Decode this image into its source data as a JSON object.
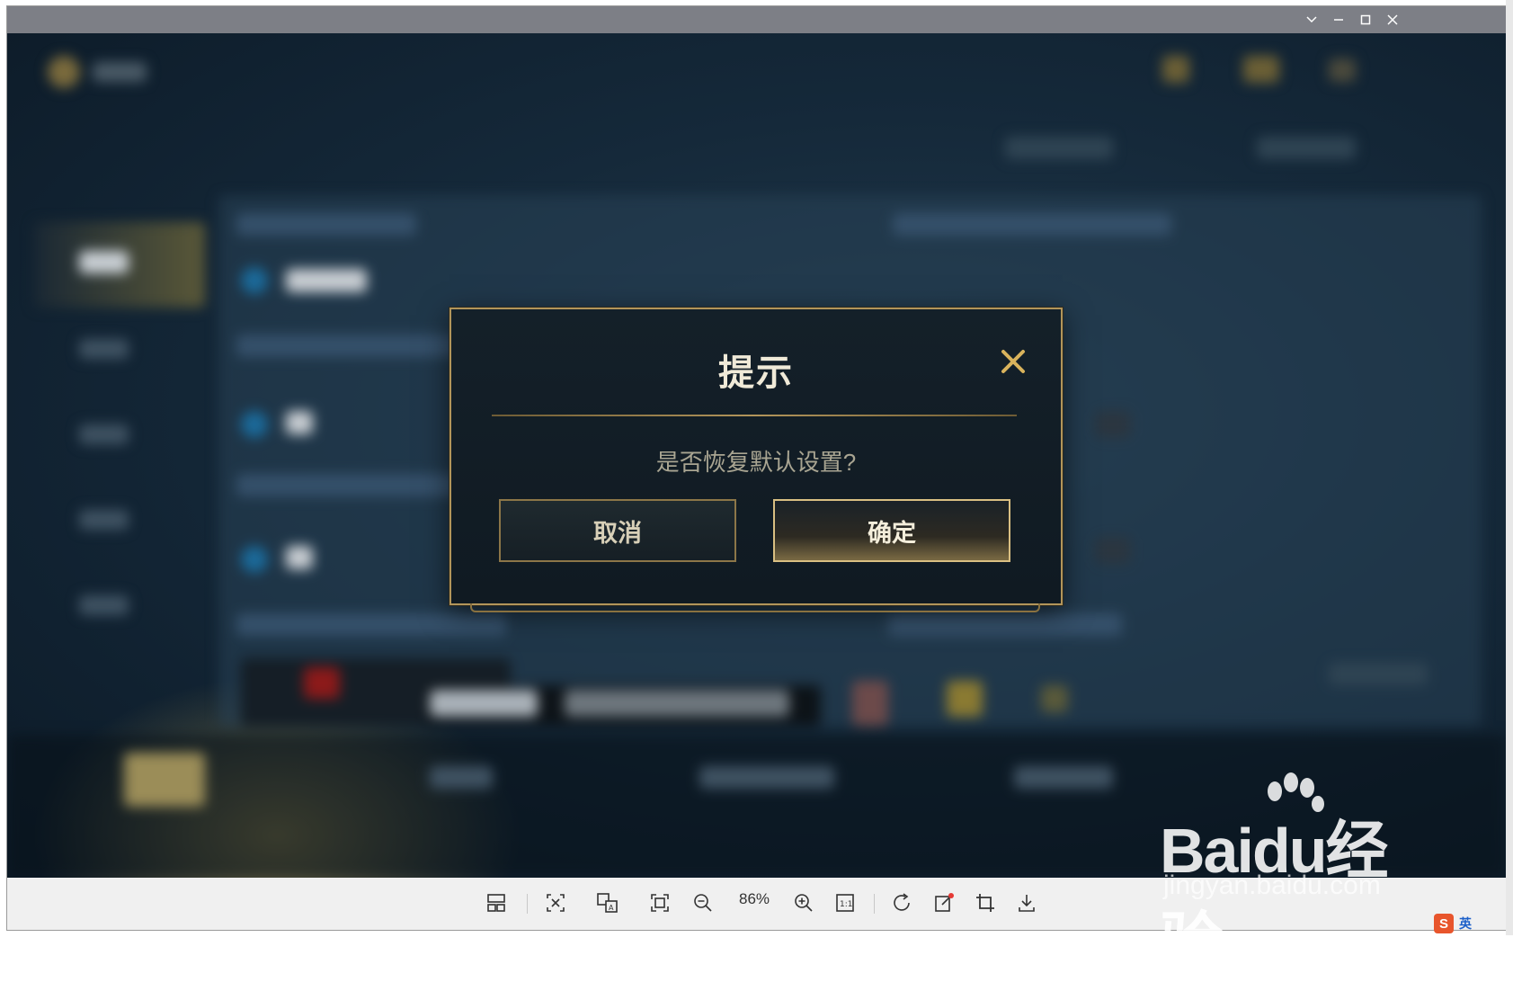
{
  "window": {
    "controls": {
      "minimize": "minimize",
      "maximize": "maximize",
      "close": "close",
      "dropdown": "more"
    }
  },
  "dialog": {
    "title": "提示",
    "message": "是否恢复默认设置?",
    "cancel_label": "取消",
    "confirm_label": "确定",
    "close_icon": "close-icon",
    "accent": "#b2955a"
  },
  "toolbar": {
    "zoom": "86%",
    "icons": [
      "layout-icon",
      "screenshot-icon",
      "translate-icon",
      "fit-screen-icon",
      "zoom-out-icon",
      "zoom-in-icon",
      "actual-size-icon",
      "rotate-icon",
      "edit-icon",
      "crop-icon",
      "download-icon"
    ]
  },
  "watermark": {
    "brand": "Bai",
    "brand_tail": "du",
    "suffix": "经验",
    "url": "jingyan.baidu.com"
  },
  "ime": {
    "label": "英"
  }
}
